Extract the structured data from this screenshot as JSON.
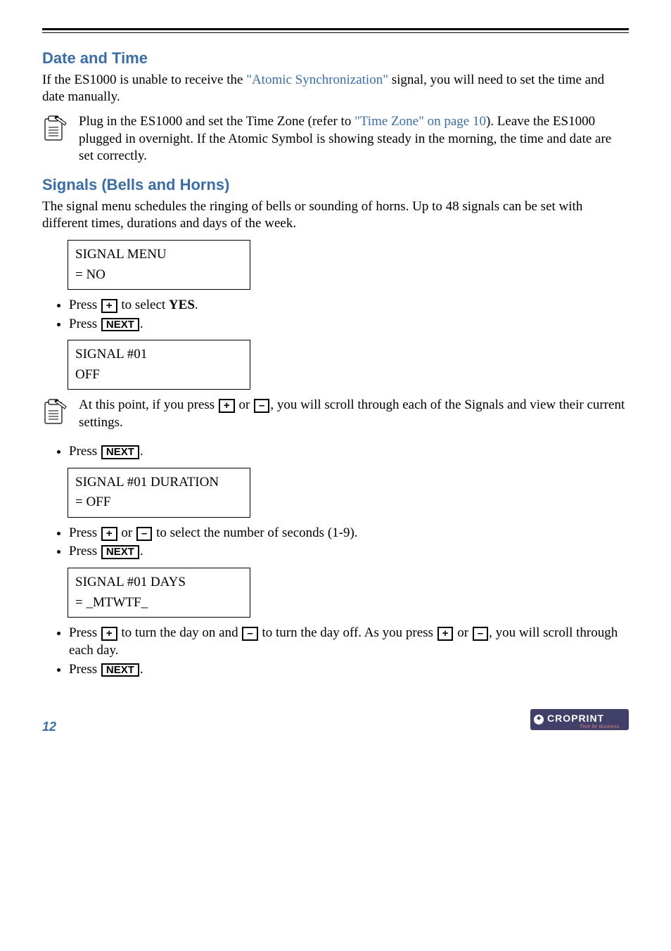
{
  "section1": {
    "title": "Date and Time",
    "intro_pre": "If the ES1000 is unable to receive the ",
    "intro_link": "\"Atomic Synchronization\"",
    "intro_post": " signal, you will need to set the time and date manually.",
    "note_pre": "Plug in the ES1000 and set the Time Zone (refer to ",
    "note_link": "\"Time Zone\" on page 10",
    "note_post": "). Leave the ES1000 plugged in overnight. If the Atomic Symbol is showing steady in the morning, the time and date are set correctly."
  },
  "section2": {
    "title": "Signals (Bells and Horns)",
    "intro": "The signal menu schedules the ringing of bells or sounding of horns. Up to 48 signals can be set with different times, durations and days of the week.",
    "box1_l1": "SIGNAL MENU",
    "box1_l2": "= NO",
    "step1a_pre": "Press ",
    "step1a_post": " to select ",
    "step1a_bold": "YES",
    "press_next": "Press ",
    "box2_l1": "SIGNAL #01",
    "box2_l2": "OFF",
    "note2_pre": "At this point, if you press ",
    "note2_mid": " or ",
    "note2_post": ", you will scroll through each of the Signals and view their current settings.",
    "box3_l1": "SIGNAL #01 DURATION",
    "box3_l2": "= OFF",
    "step3a_pre": "Press ",
    "step3a_mid": " or ",
    "step3a_post": " to select the number of seconds (1-9).",
    "box4_l1": "SIGNAL #01 DAYS",
    "box4_l2": "= _MTWTF_",
    "step4a_pre": "Press ",
    "step4a_mid1": " to turn the day on and ",
    "step4a_mid2": " to turn the day off. As you press ",
    "step4a_mid3": " or ",
    "step4a_post": ", you will scroll through each day."
  },
  "buttons": {
    "plus": "+",
    "minus": "–",
    "next": "NEXT"
  },
  "period": ".",
  "page_number": "12",
  "logo": {
    "brand": "CROPRINT",
    "tag": "Time for Business."
  }
}
